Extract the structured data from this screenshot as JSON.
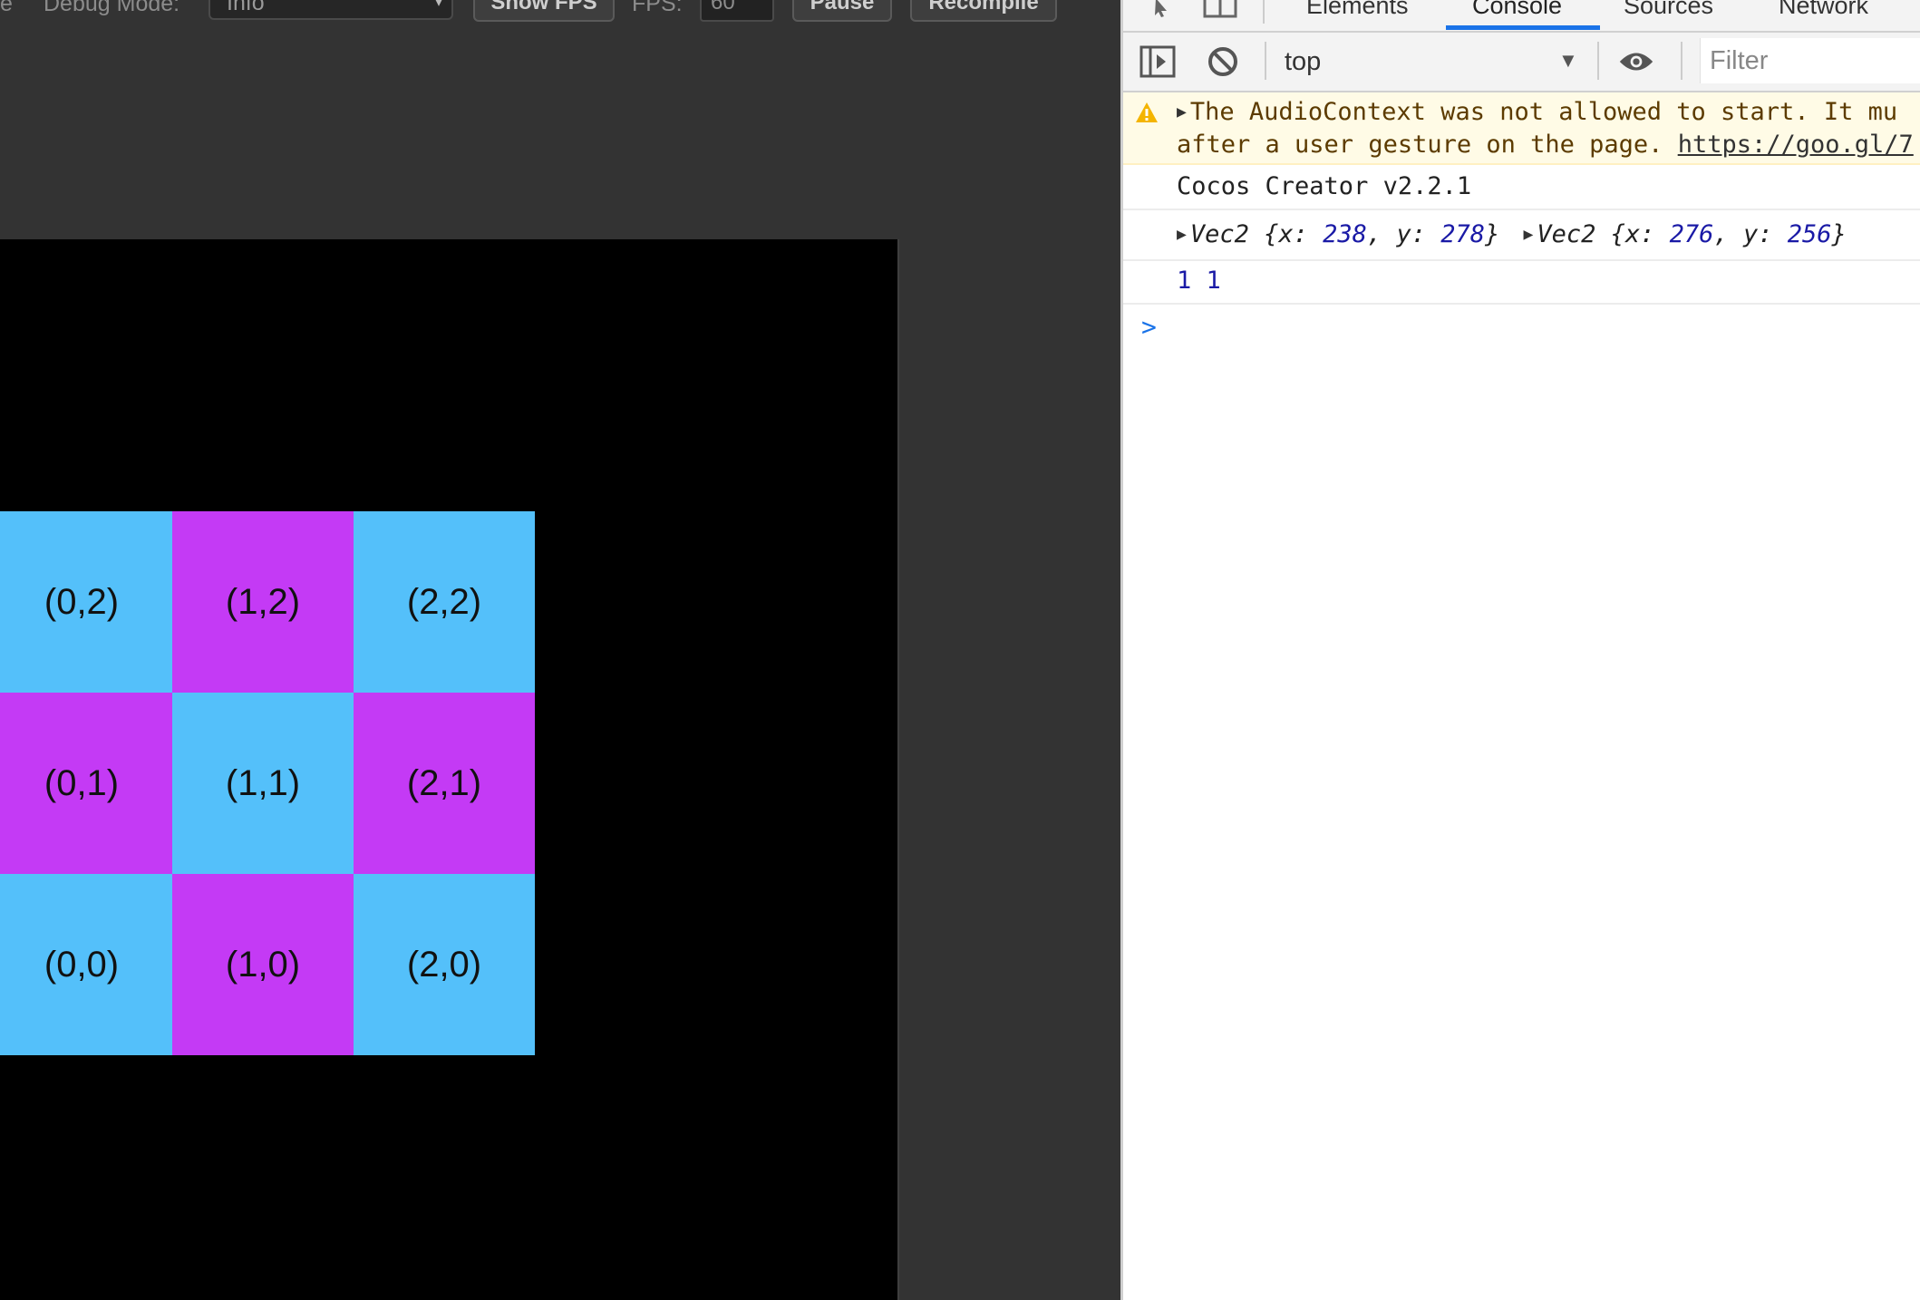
{
  "preview": {
    "toolbar": {
      "partial_left_label": "e",
      "debug_mode_label": "Debug Mode:",
      "debug_mode_value": "Info",
      "show_fps_label": "Show FPS",
      "fps_label": "FPS:",
      "fps_value": "60",
      "pause_label": "Pause",
      "recompile_label": "Recompile"
    },
    "tiles": [
      {
        "label": "(0,2)",
        "color": "#54c0fa"
      },
      {
        "label": "(1,2)",
        "color": "#c43af5"
      },
      {
        "label": "(2,2)",
        "color": "#54c0fa"
      },
      {
        "label": "(0,1)",
        "color": "#c43af5"
      },
      {
        "label": "(1,1)",
        "color": "#54c0fa"
      },
      {
        "label": "(2,1)",
        "color": "#c43af5"
      },
      {
        "label": "(0,0)",
        "color": "#54c0fa"
      },
      {
        "label": "(1,0)",
        "color": "#c43af5"
      },
      {
        "label": "(2,0)",
        "color": "#54c0fa"
      }
    ]
  },
  "devtools": {
    "tabs": [
      {
        "label": "Elements",
        "active": false
      },
      {
        "label": "Console",
        "active": true
      },
      {
        "label": "Sources",
        "active": false
      },
      {
        "label": "Network",
        "active": false
      }
    ],
    "toolbar": {
      "context": "top",
      "filter_placeholder": "Filter"
    },
    "console": {
      "warning_line1": "The AudioContext was not allowed to start. It mu",
      "warning_line2_text": "after a user gesture on the page. ",
      "warning_link": "https://goo.gl/7",
      "version_line": "Cocos Creator v2.2.1",
      "vec_a": {
        "type": "Vec2",
        "x": "238",
        "y": "278"
      },
      "vec_b": {
        "type": "Vec2",
        "x": "276",
        "y": "256"
      },
      "numbers_line": "1 1",
      "prompt": ">"
    },
    "accent_color": "#1a73e8"
  }
}
